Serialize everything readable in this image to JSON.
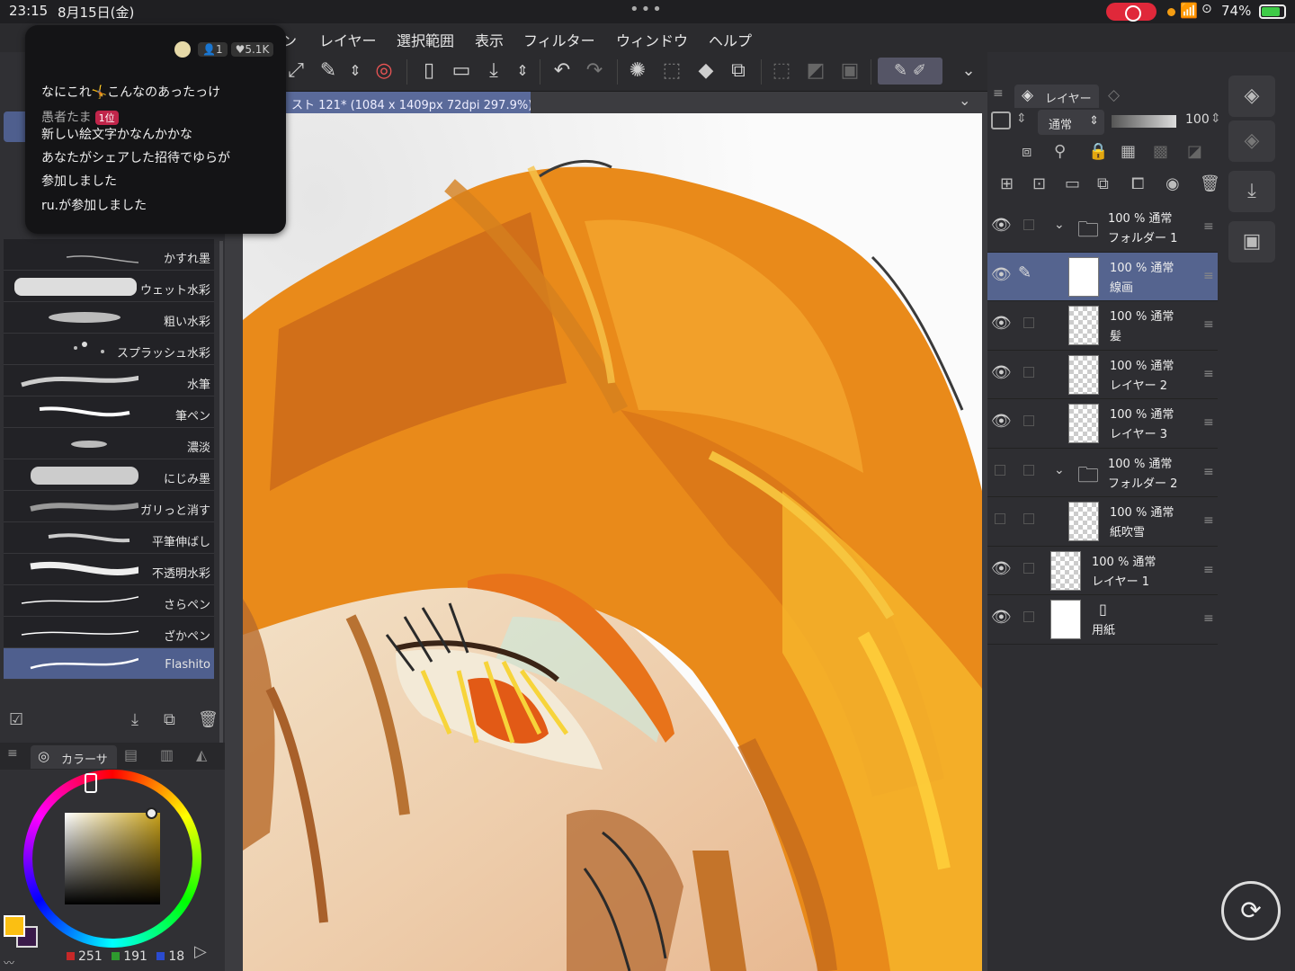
{
  "status": {
    "time": "23:15",
    "date": "8月15日(金)",
    "battery": "74%",
    "dots": "•••"
  },
  "menu": {
    "items": [
      "レイヤー",
      "選択範囲",
      "表示",
      "フィルター",
      "ウィンドウ",
      "ヘルプ"
    ],
    "partial": "ン"
  },
  "notification": {
    "viewers": "1",
    "likes": "5.1K",
    "line1": "なにこれ🤸こんなのあったっけ",
    "user": "愚者たま",
    "rank": "1位",
    "line2": "新しい絵文字かなんかかな",
    "line3": "あなたがシェアした招待でゆらが",
    "line4": "参加しました",
    "line5": "ru.が参加しました"
  },
  "document": {
    "tab_title": "スト 121* (1084 x 1409px 72dpi 297.9%)"
  },
  "brushes": [
    {
      "name": "かすれ墨",
      "selected": false
    },
    {
      "name": "ウェット水彩",
      "selected": false
    },
    {
      "name": "粗い水彩",
      "selected": false
    },
    {
      "name": "スプラッシュ水彩",
      "selected": false
    },
    {
      "name": "水筆",
      "selected": false
    },
    {
      "name": "筆ペン",
      "selected": false
    },
    {
      "name": "濃淡",
      "selected": false
    },
    {
      "name": "にじみ墨",
      "selected": false
    },
    {
      "name": "ガリっと消す",
      "selected": false
    },
    {
      "name": "平筆伸ばし",
      "selected": false
    },
    {
      "name": "不透明水彩",
      "selected": false
    },
    {
      "name": "さらペン",
      "selected": false
    },
    {
      "name": "ざかペン",
      "selected": false
    },
    {
      "name": "Flashito",
      "selected": true
    }
  ],
  "color": {
    "tab_label": "カラーサ",
    "r": "251",
    "g": "191",
    "b": "18",
    "fg": "#fbbf12",
    "bg": "#3a1a4a"
  },
  "layers_panel": {
    "tab_label": "レイヤー",
    "blend_mode": "通常",
    "opacity": "100",
    "layers": [
      {
        "kind": "folder",
        "l1": "100 % 通常",
        "l2": "フォルダー 1",
        "visible": true,
        "selected": false,
        "indent": 0
      },
      {
        "kind": "layer",
        "l1": "100 % 通常",
        "l2": "線画",
        "visible": true,
        "selected": true,
        "indent": 1,
        "editing": true
      },
      {
        "kind": "layer",
        "l1": "100 % 通常",
        "l2": "髪",
        "visible": true,
        "selected": false,
        "indent": 1
      },
      {
        "kind": "layer",
        "l1": "100 % 通常",
        "l2": "レイヤー 2",
        "visible": true,
        "selected": false,
        "indent": 1
      },
      {
        "kind": "layer",
        "l1": "100 % 通常",
        "l2": "レイヤー 3",
        "visible": true,
        "selected": false,
        "indent": 1
      },
      {
        "kind": "folder",
        "l1": "100 % 通常",
        "l2": "フォルダー 2",
        "visible": false,
        "selected": false,
        "indent": 0
      },
      {
        "kind": "layer",
        "l1": "100 % 通常",
        "l2": "紙吹雪",
        "visible": false,
        "selected": false,
        "indent": 1
      },
      {
        "kind": "layer",
        "l1": "100 % 通常",
        "l2": "レイヤー 1",
        "visible": true,
        "selected": false,
        "indent": 0
      },
      {
        "kind": "paper",
        "l1": "",
        "l2": "用紙",
        "visible": true,
        "selected": false,
        "indent": 0
      }
    ]
  }
}
